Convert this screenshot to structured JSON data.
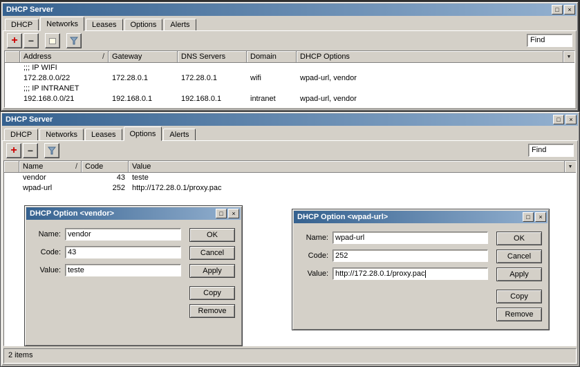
{
  "colors": {
    "titlebar_gradient_start": "#35618f",
    "titlebar_gradient_end": "#94b1d0",
    "window_bg": "#d4d0c8",
    "add_button_red": "#cc0000",
    "table_bg": "#ffffff"
  },
  "icons": {
    "maximize": "□",
    "close": "×",
    "add": "+",
    "remove": "−",
    "sort_asc": "/",
    "column_select": "▼"
  },
  "networks_window": {
    "title": "DHCP Server",
    "tabs": [
      {
        "label": "DHCP"
      },
      {
        "label": "Networks",
        "active": true
      },
      {
        "label": "Leases"
      },
      {
        "label": "Options"
      },
      {
        "label": "Alerts"
      }
    ],
    "find_placeholder": "Find",
    "columns": {
      "address": "Address",
      "gateway": "Gateway",
      "dns": "DNS Servers",
      "domain": "Domain",
      "options": "DHCP Options"
    },
    "rows": [
      {
        "type": "comment",
        "label": ";;; IP WIFI"
      },
      {
        "type": "data",
        "address": "172.28.0.0/22",
        "gateway": "172.28.0.1",
        "dns": "172.28.0.1",
        "domain": "wifi",
        "options": "wpad-url, vendor"
      },
      {
        "type": "comment",
        "label": ";;; IP INTRANET"
      },
      {
        "type": "data",
        "address": "192.168.0.0/21",
        "gateway": "192.168.0.1",
        "dns": "192.168.0.1",
        "domain": "intranet",
        "options": "wpad-url, vendor"
      }
    ]
  },
  "options_window": {
    "title": "DHCP Server",
    "tabs": [
      {
        "label": "DHCP"
      },
      {
        "label": "Networks"
      },
      {
        "label": "Leases"
      },
      {
        "label": "Options",
        "active": true
      },
      {
        "label": "Alerts"
      }
    ],
    "find_placeholder": "Find",
    "columns": {
      "name": "Name",
      "code": "Code",
      "value": "Value"
    },
    "rows": [
      {
        "name": "vendor",
        "code": "43",
        "value": "teste"
      },
      {
        "name": "wpad-url",
        "code": "252",
        "value": "http://172.28.0.1/proxy.pac"
      }
    ],
    "status": "2 items"
  },
  "vendor_dialog": {
    "title": "DHCP Option <vendor>",
    "name_label": "Name:",
    "name_value": "vendor",
    "code_label": "Code:",
    "code_value": "43",
    "value_label": "Value:",
    "value_value": "teste",
    "buttons": {
      "ok": "OK",
      "cancel": "Cancel",
      "apply": "Apply",
      "copy": "Copy",
      "remove": "Remove"
    }
  },
  "wpad_dialog": {
    "title": "DHCP Option <wpad-url>",
    "name_label": "Name:",
    "name_value": "wpad-url",
    "code_label": "Code:",
    "code_value": "252",
    "value_label": "Value:",
    "value_value": "http://172.28.0.1/proxy.pac",
    "buttons": {
      "ok": "OK",
      "cancel": "Cancel",
      "apply": "Apply",
      "copy": "Copy",
      "remove": "Remove"
    }
  }
}
